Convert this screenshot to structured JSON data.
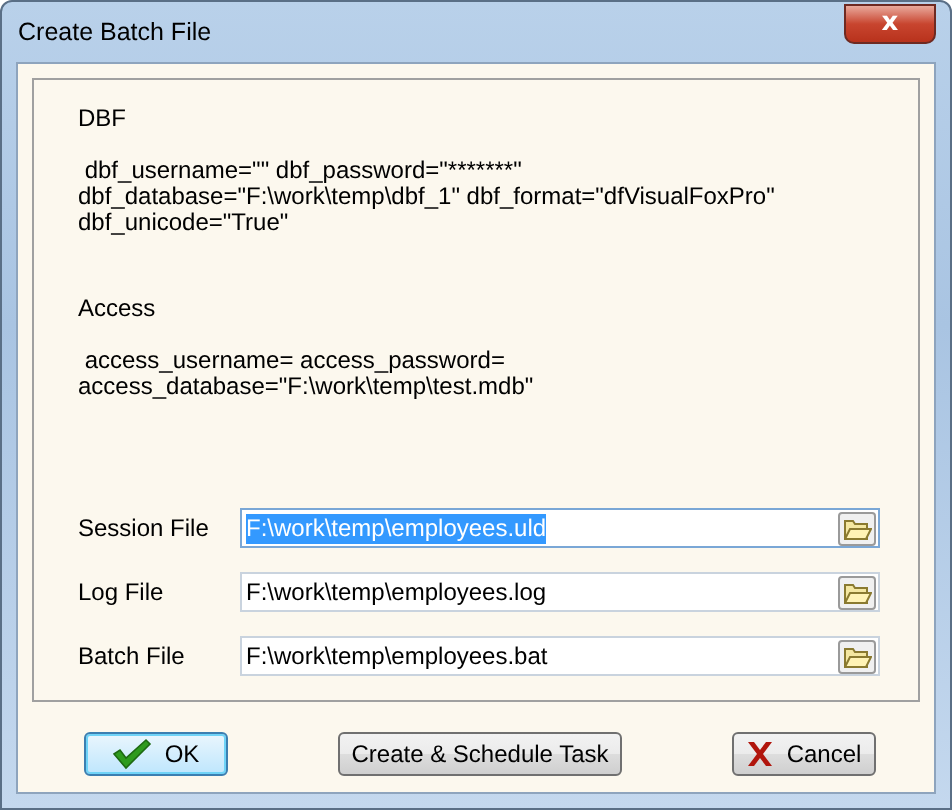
{
  "window": {
    "title": "Create Batch File",
    "close_label": "x"
  },
  "sections": [
    {
      "heading": "DBF",
      "lines": [
        " dbf_username=\"\" dbf_password=\"*******\"",
        "dbf_database=\"F:\\work\\temp\\dbf_1\" dbf_format=\"dfVisualFoxPro\"",
        "dbf_unicode=\"True\""
      ]
    },
    {
      "heading": "Access",
      "lines": [
        " access_username= access_password=",
        "access_database=\"F:\\work\\temp\\test.mdb\""
      ]
    }
  ],
  "fields": [
    {
      "label": "Session File",
      "value": "F:\\work\\temp\\employees.uld",
      "selected": true
    },
    {
      "label": "Log File",
      "value": "F:\\work\\temp\\employees.log",
      "selected": false
    },
    {
      "label": "Batch File",
      "value": "F:\\work\\temp\\employees.bat",
      "selected": false
    }
  ],
  "buttons": [
    {
      "label": "OK",
      "kind": "ok",
      "default": true
    },
    {
      "label": "Create & Schedule Task",
      "kind": "plain",
      "default": false
    },
    {
      "label": "Cancel",
      "kind": "cancel",
      "default": false
    }
  ]
}
